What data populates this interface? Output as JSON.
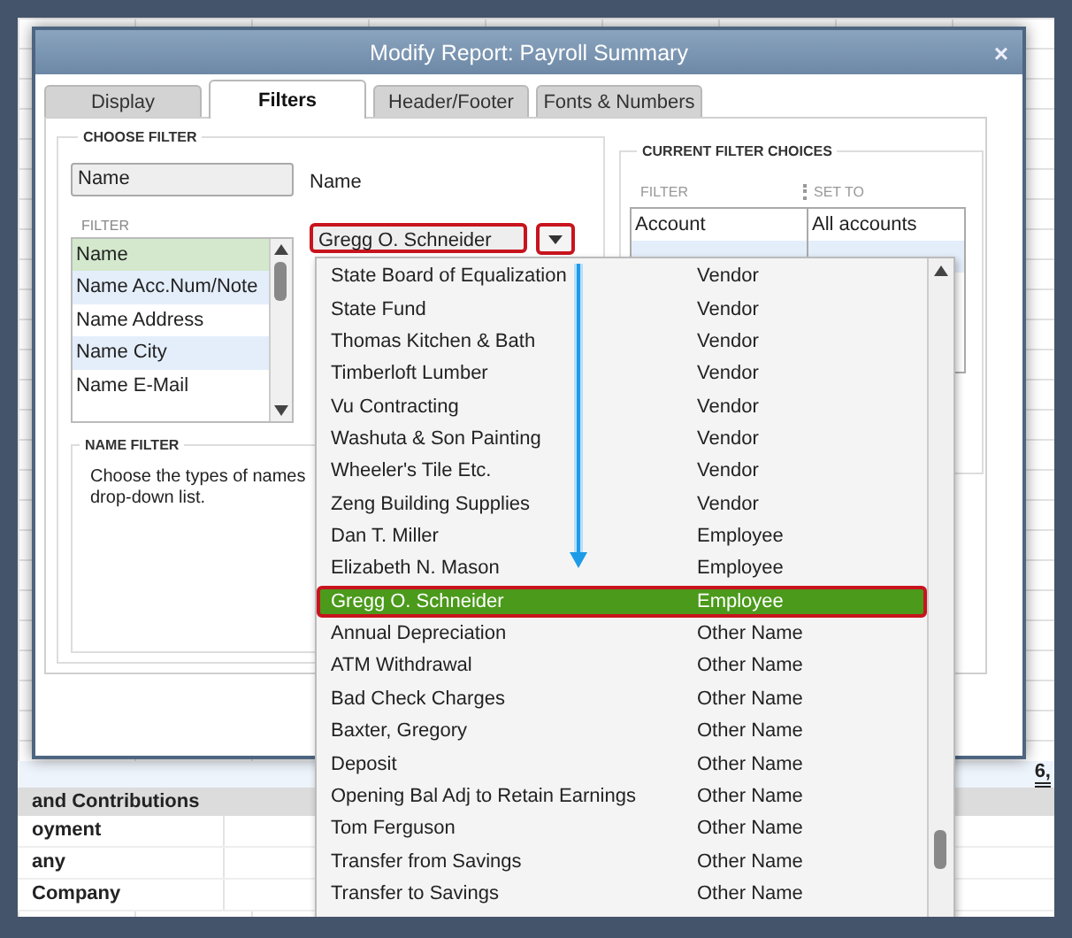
{
  "dialog": {
    "title": "Modify Report: Payroll Summary",
    "close": "×"
  },
  "tabs": [
    {
      "label": "Display",
      "selected": false
    },
    {
      "label": "Filters",
      "selected": true
    },
    {
      "label": "Header/Footer",
      "selected": false
    },
    {
      "label": "Fonts & Numbers",
      "selected": false
    }
  ],
  "choose_filter": {
    "heading": "CHOOSE FILTER",
    "search_value": "Name",
    "list_heading": "FILTER",
    "field_label": "Name",
    "filters": [
      {
        "label": "Name",
        "selected": true
      },
      {
        "label": "Name Acc.Num/Note",
        "selected": false
      },
      {
        "label": "Name Address",
        "selected": false
      },
      {
        "label": "Name City",
        "selected": false
      },
      {
        "label": "Name E-Mail",
        "selected": false
      }
    ],
    "name_field": {
      "value": "Gregg O. Schneider",
      "highlighted": true
    },
    "dropdown_button": {
      "highlighted": true
    }
  },
  "name_filter": {
    "heading": "NAME FILTER",
    "lines": [
      "Choose the types of names",
      "drop-down list."
    ]
  },
  "current_filter_choices": {
    "heading": "CURRENT FILTER CHOICES",
    "columns": [
      "FILTER",
      "SET TO"
    ],
    "rows": [
      [
        "Account",
        "All accounts"
      ]
    ]
  },
  "dropdown": {
    "pointer_arrow": true,
    "items": [
      {
        "name": "State Board of Equalization",
        "type": "Vendor",
        "selected": false
      },
      {
        "name": "State Fund",
        "type": "Vendor",
        "selected": false
      },
      {
        "name": "Thomas Kitchen & Bath",
        "type": "Vendor",
        "selected": false
      },
      {
        "name": "Timberloft Lumber",
        "type": "Vendor",
        "selected": false
      },
      {
        "name": "Vu Contracting",
        "type": "Vendor",
        "selected": false
      },
      {
        "name": "Washuta & Son Painting",
        "type": "Vendor",
        "selected": false
      },
      {
        "name": "Wheeler's Tile Etc.",
        "type": "Vendor",
        "selected": false
      },
      {
        "name": "Zeng Building Supplies",
        "type": "Vendor",
        "selected": false
      },
      {
        "name": "Dan T. Miller",
        "type": "Employee",
        "selected": false
      },
      {
        "name": "Elizabeth N. Mason",
        "type": "Employee",
        "selected": false
      },
      {
        "name": "Gregg O. Schneider",
        "type": "Employee",
        "selected": true
      },
      {
        "name": "Annual Depreciation",
        "type": "Other Name",
        "selected": false
      },
      {
        "name": "ATM Withdrawal",
        "type": "Other Name",
        "selected": false
      },
      {
        "name": "Bad Check Charges",
        "type": "Other Name",
        "selected": false
      },
      {
        "name": "Baxter, Gregory",
        "type": "Other Name",
        "selected": false
      },
      {
        "name": "Deposit",
        "type": "Other Name",
        "selected": false
      },
      {
        "name": "Opening Bal Adj to Retain Earnings",
        "type": "Other Name",
        "selected": false
      },
      {
        "name": "Tom Ferguson",
        "type": "Other Name",
        "selected": false
      },
      {
        "name": "Transfer from Savings",
        "type": "Other Name",
        "selected": false
      },
      {
        "name": "Transfer to Savings",
        "type": "Other Name",
        "selected": false
      }
    ]
  },
  "report": {
    "total": "6,",
    "section": "and Contributions",
    "rows": [
      "oyment",
      "any",
      "Company"
    ]
  }
}
